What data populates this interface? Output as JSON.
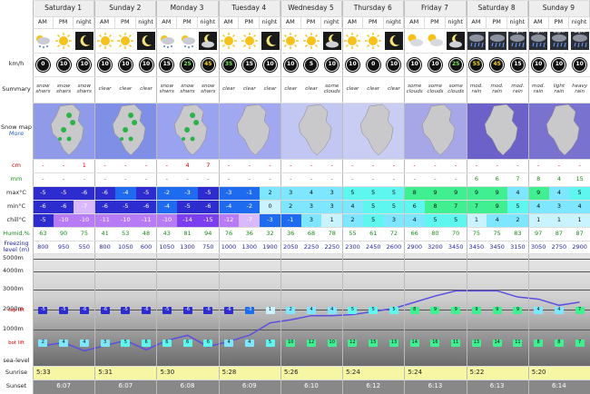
{
  "days": [
    "Saturday 1",
    "Sunday 2",
    "Monday 3",
    "Tuesday 4",
    "Wednesday 5",
    "Thursday 6",
    "Friday 7",
    "Saturday 8",
    "Sunday 9"
  ],
  "periods": [
    "AM",
    "PM",
    "night"
  ],
  "icon_labels": {
    "23": "Light",
    "24": "Light",
    "25": "Light",
    "26": "Light"
  },
  "row_labels": {
    "wind": "km/h",
    "summary": "Summary",
    "snowmap": "Snow map",
    "snowmap_more": "More",
    "snow": "cm",
    "rain": "mm",
    "max": "max°C",
    "min": "min°C",
    "chill": "chill°C",
    "humid": "Humid.%",
    "freezing": "Freezing level (m)",
    "sealevel": "sea-level",
    "sunrise": "Sunrise",
    "sunset": "Sunset",
    "top": "top lift",
    "bot": "bot lift"
  },
  "alt_labels": [
    "5000m",
    "4000m",
    "3000m",
    "2000m",
    "1000m"
  ],
  "wind": [
    "0",
    "10",
    "10",
    "10",
    "10",
    "10",
    "15",
    "25",
    "45",
    "35",
    "15",
    "10",
    "10",
    "5",
    "10",
    "10",
    "0",
    "10",
    "10",
    "10",
    "25",
    "55",
    "45",
    "15",
    "10",
    "10",
    "10"
  ],
  "summary": [
    "snow shwrs",
    "snow shwrs",
    "snow shwrs",
    "clear",
    "clear",
    "clear",
    "snow shwrs",
    "snow shwrs",
    "snow shwrs",
    "clear",
    "clear",
    "clear",
    "clear",
    "clear",
    "some clouds",
    "clear",
    "clear",
    "clear",
    "some clouds",
    "some clouds",
    "some clouds",
    "mod. rain",
    "mod. rain",
    "mod. rain",
    "mod. rain",
    "light rain",
    "heavy rain"
  ],
  "snow": [
    "-",
    "-",
    "1",
    "-",
    "-",
    "-",
    "-",
    "4",
    "7",
    "-",
    "-",
    "-",
    "-",
    "-",
    "-",
    "-",
    "-",
    "-",
    "-",
    "-",
    "-",
    "-",
    "-",
    "-",
    "-",
    "-",
    "-"
  ],
  "rain": [
    "-",
    "-",
    "-",
    "-",
    "-",
    "-",
    "-",
    "-",
    "-",
    "-",
    "-",
    "-",
    "-",
    "-",
    "-",
    "-",
    "-",
    "-",
    "-",
    "-",
    "-",
    "6",
    "6",
    "7",
    "8",
    "4",
    "15"
  ],
  "max": [
    "-5",
    "-5",
    "-6",
    "-6",
    "-4",
    "-5",
    "-2",
    "-3",
    "-5",
    "-3",
    "-1",
    "2",
    "3",
    "4",
    "3",
    "5",
    "5",
    "5",
    "8",
    "9",
    "9",
    "9",
    "9",
    "4",
    "9",
    "4",
    "5"
  ],
  "min": [
    "-6",
    "-6",
    "-7",
    "-6",
    "-5",
    "-6",
    "-4",
    "-5",
    "-6",
    "-4",
    "-2",
    "0",
    "2",
    "3",
    "3",
    "4",
    "5",
    "5",
    "6",
    "8",
    "7",
    "7",
    "9",
    "5",
    "4",
    "3",
    "4"
  ],
  "chill": [
    "-5",
    "-10",
    "-10",
    "-11",
    "-10",
    "-11",
    "-10",
    "-14",
    "-15",
    "-12",
    "-7",
    "-3",
    "-1",
    "3",
    "1",
    "2",
    "5",
    "3",
    "4",
    "5",
    "5",
    "1",
    "4",
    "2",
    "1",
    "1",
    "1"
  ],
  "humid": [
    "63",
    "90",
    "75",
    "41",
    "53",
    "48",
    "43",
    "81",
    "94",
    "76",
    "36",
    "32",
    "36",
    "68",
    "78",
    "55",
    "61",
    "72",
    "66",
    "80",
    "70",
    "75",
    "75",
    "83",
    "97",
    "87",
    "87"
  ],
  "freezing": [
    "800",
    "950",
    "550",
    "800",
    "1050",
    "600",
    "1050",
    "1300",
    "750",
    "1000",
    "1300",
    "1900",
    "2050",
    "2250",
    "2250",
    "2300",
    "2450",
    "2600",
    "2900",
    "3200",
    "3450",
    "3450",
    "3450",
    "3150",
    "3050",
    "2750",
    "2900"
  ],
  "top_temps": [
    "-5",
    "-5",
    "-6",
    "-6",
    "-5",
    "-6",
    "-5",
    "-6",
    "-6",
    "-6",
    "-3",
    "1",
    "2",
    "4",
    "4",
    "5",
    "5",
    "5",
    "8",
    "9",
    "9",
    "9",
    "9",
    "9",
    "4",
    "4",
    "7"
  ],
  "bot_temps": [
    "2",
    "4",
    "4",
    "3",
    "5",
    "6",
    "6",
    "6",
    "6",
    "4",
    "4",
    "5",
    "10",
    "12",
    "10",
    "12",
    "15",
    "13",
    "14",
    "16",
    "11",
    "13",
    "14",
    "11",
    "8",
    "8",
    "7"
  ],
  "sunrise": [
    "5:33",
    "5:31",
    "5:30",
    "5:28",
    "5:26",
    "5:24",
    "5:24",
    "5:22",
    "5:20"
  ],
  "sunset": [
    "6:07",
    "6:07",
    "6:08",
    "6:09",
    "6:10",
    "6:12",
    "6:13",
    "6:13",
    "6:14"
  ],
  "colors": {
    "blue": "#1e6bf0",
    "navy": "#2c2ccf",
    "purple": "#7b3ff0",
    "violet": "#b77cf5",
    "lavender": "#d9b9fb",
    "cyan": "#7ee6ff",
    "aqua": "#5ff6f0",
    "green": "#40f090",
    "sunrise_bg": "#f7f6a4",
    "sunset_bg": "#888888"
  }
}
